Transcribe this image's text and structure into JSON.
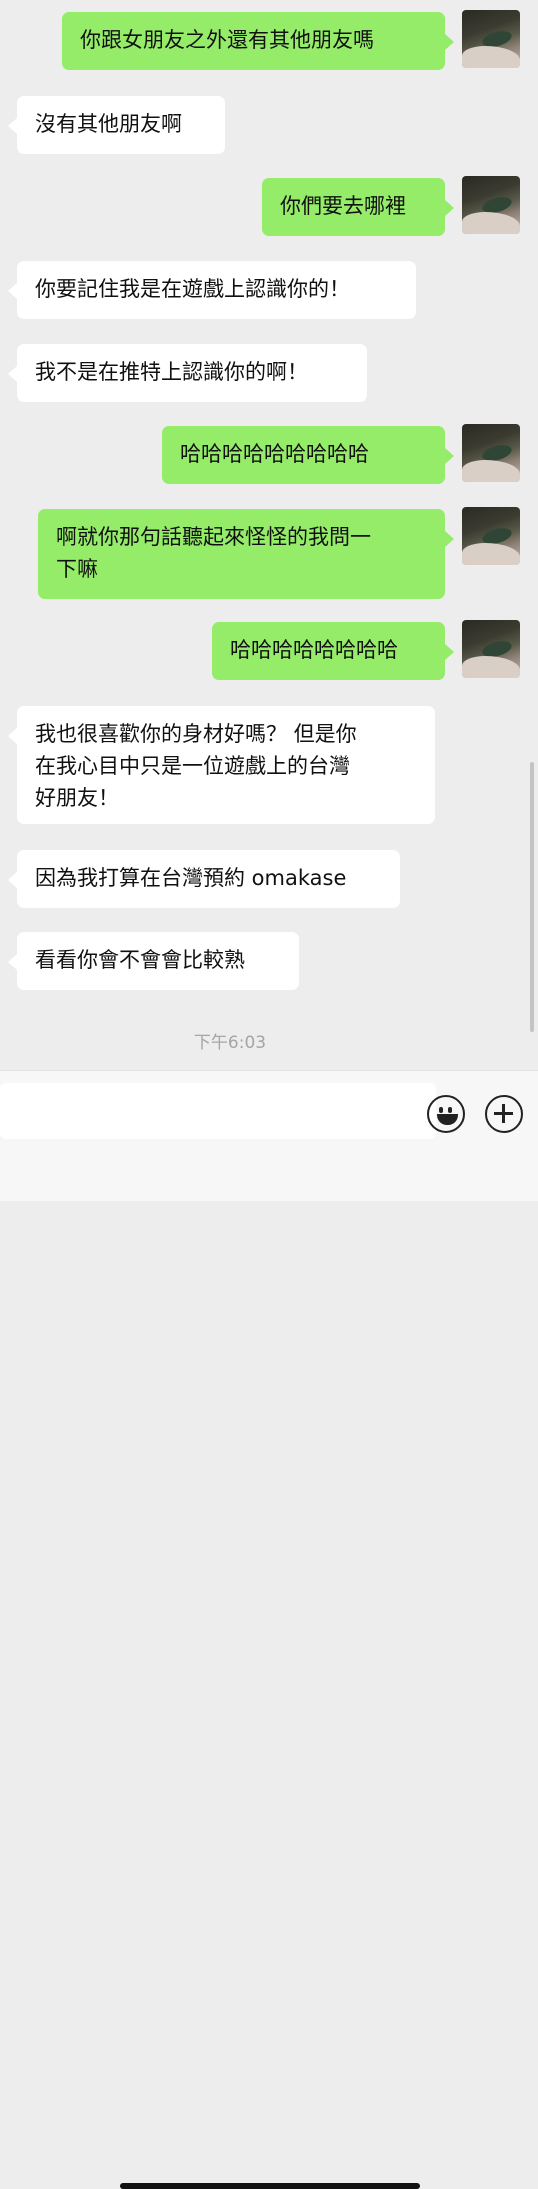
{
  "messages": [
    {
      "side": "out",
      "lines": [
        "你跟女朋友之外還有其他朋友嗎"
      ]
    },
    {
      "side": "in",
      "lines": [
        "沒有其他朋友啊"
      ]
    },
    {
      "side": "out",
      "lines": [
        "你們要去哪裡"
      ]
    },
    {
      "side": "in",
      "lines": [
        "你要記住我是在遊戲上認識你的！"
      ]
    },
    {
      "side": "in",
      "lines": [
        "我不是在推特上認識你的啊！"
      ]
    },
    {
      "side": "out",
      "lines": [
        "哈哈哈哈哈哈哈哈哈"
      ]
    },
    {
      "side": "out",
      "lines": [
        "啊就你那句話聽起來怪怪的我問一",
        "下嘛"
      ]
    },
    {
      "side": "out",
      "lines": [
        "哈哈哈哈哈哈哈哈"
      ]
    },
    {
      "side": "in",
      "lines": [
        "我也很喜歡你的身材好嗎？ 但是你",
        "在我心目中只是一位遊戲上的台灣",
        "好朋友！"
      ]
    },
    {
      "side": "in",
      "lines": [
        "因為我打算在台灣預約 omakase"
      ]
    },
    {
      "side": "in",
      "lines": [
        "看看你會不會會比較熟"
      ]
    }
  ],
  "timestamp": "下午6:03",
  "input": {
    "value": ""
  },
  "icons": {
    "emoji": "emoji-icon",
    "plus": "plus-icon"
  }
}
